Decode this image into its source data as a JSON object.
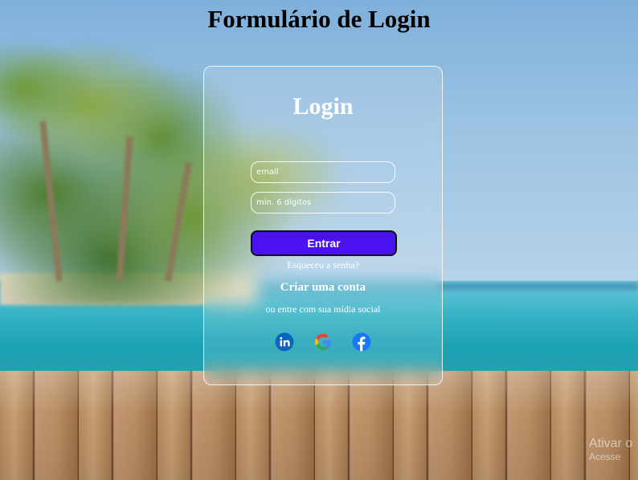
{
  "page": {
    "title": "Formulário de Login"
  },
  "login_card": {
    "title": "Login",
    "email_placeholder": "email",
    "password_placeholder": "min. 6 dígitos",
    "submit_label": "Entrar",
    "forgot_password_link": "Esqueceu a senha?",
    "create_account_link": "Criar uma conta",
    "social_prompt": "ou entre com sua mídia social",
    "social_buttons": [
      {
        "name": "LinkedIn",
        "icon": "linkedin-icon",
        "color": "#0a66c2"
      },
      {
        "name": "Google",
        "icon": "google-icon",
        "color": "#4285f4"
      },
      {
        "name": "Facebook",
        "icon": "facebook-icon",
        "color": "#1877f2"
      }
    ]
  },
  "colors": {
    "submit_button": "#4a12ee",
    "card_border": "#ffffff"
  },
  "watermark": {
    "title": "Ativar o",
    "subtitle": "Acesse"
  }
}
